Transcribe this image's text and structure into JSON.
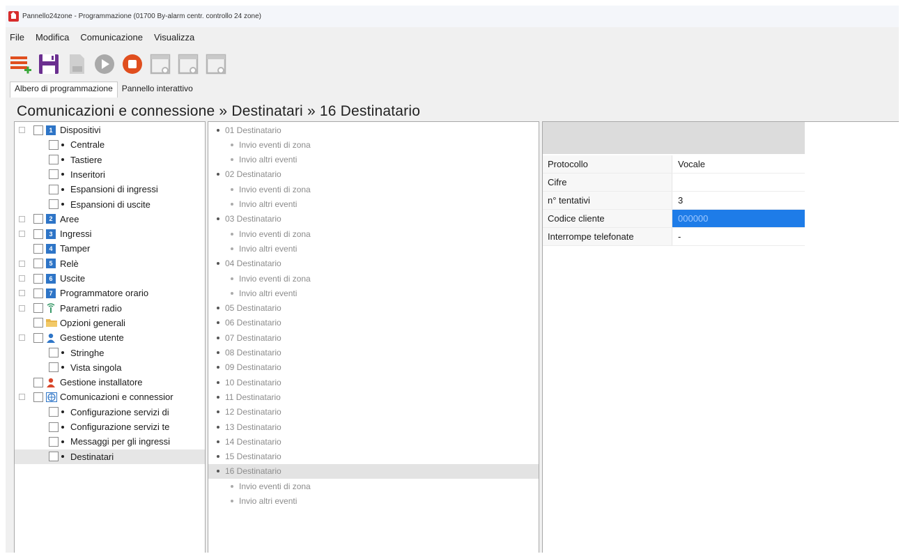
{
  "window": {
    "title": "Pannello24zone - Programmazione (01700  By-alarm centr. controllo 24 zone)"
  },
  "menu": [
    "File",
    "Modifica",
    "Comunicazione",
    "Visualizza"
  ],
  "toolbar": {
    "icons": [
      "list-add-icon",
      "save-icon",
      "document-icon",
      "play-icon",
      "stop-icon",
      "window-icon",
      "window-icon",
      "window-icon"
    ],
    "colors": {
      "red": "#e04e1e",
      "purple": "#6b2f90",
      "grey": "#a9a9a9"
    }
  },
  "tabs": [
    "Albero di programmazione",
    "Pannello interattivo"
  ],
  "breadcrumb": "Comunicazioni e connessione » Destinatari » 16 Destinatario",
  "tree": [
    {
      "label": "Dispositivi",
      "level": 0,
      "expander": "⊟",
      "icon": "1"
    },
    {
      "label": "Centrale",
      "level": 1
    },
    {
      "label": "Tastiere",
      "level": 1
    },
    {
      "label": "Inseritori",
      "level": 1
    },
    {
      "label": "Espansioni di ingressi",
      "level": 1
    },
    {
      "label": "Espansioni di uscite",
      "level": 1
    },
    {
      "label": "Aree",
      "level": 0,
      "expander": "⊞",
      "icon": "2"
    },
    {
      "label": "Ingressi",
      "level": 0,
      "expander": "⊞",
      "icon": "3"
    },
    {
      "label": "Tamper",
      "level": 0,
      "icon": "4"
    },
    {
      "label": "Relè",
      "level": 0,
      "expander": "⊞",
      "icon": "5"
    },
    {
      "label": "Uscite",
      "level": 0,
      "expander": "⊞",
      "icon": "6"
    },
    {
      "label": "Programmatore orario",
      "level": 0,
      "expander": "⊞",
      "icon": "7"
    },
    {
      "label": "Parametri radio",
      "level": 0,
      "expander": "⊞",
      "icon": "radio-antenna-icon"
    },
    {
      "label": "Opzioni generali",
      "level": 0,
      "icon": "folder-icon"
    },
    {
      "label": "Gestione utente",
      "level": 0,
      "expander": "⊟",
      "icon": "user-icon"
    },
    {
      "label": "Stringhe",
      "level": 1
    },
    {
      "label": "Vista singola",
      "level": 1
    },
    {
      "label": "Gestione installatore",
      "level": 0,
      "icon": "installer-icon"
    },
    {
      "label": "Comunicazioni e connessior",
      "level": 0,
      "expander": "⊟",
      "icon": "globe-icon"
    },
    {
      "label": "Configurazione servizi di",
      "level": 1
    },
    {
      "label": "Configurazione servizi te",
      "level": 1
    },
    {
      "label": "Messaggi per gli ingressi",
      "level": 1
    },
    {
      "label": "Destinatari",
      "level": 1,
      "selected": true
    }
  ],
  "recipients": [
    {
      "label": "01 Destinatario",
      "level": 0
    },
    {
      "label": "Invio eventi di zona",
      "level": 1
    },
    {
      "label": "Invio altri eventi",
      "level": 1
    },
    {
      "label": "02 Destinatario",
      "level": 0
    },
    {
      "label": "Invio eventi di zona",
      "level": 1
    },
    {
      "label": "Invio altri eventi",
      "level": 1
    },
    {
      "label": "03 Destinatario",
      "level": 0
    },
    {
      "label": "Invio eventi di zona",
      "level": 1
    },
    {
      "label": "Invio altri eventi",
      "level": 1
    },
    {
      "label": "04 Destinatario",
      "level": 0
    },
    {
      "label": "Invio eventi di zona",
      "level": 1
    },
    {
      "label": "Invio altri eventi",
      "level": 1
    },
    {
      "label": "05 Destinatario",
      "level": 0
    },
    {
      "label": "06 Destinatario",
      "level": 0
    },
    {
      "label": "07 Destinatario",
      "level": 0
    },
    {
      "label": "08 Destinatario",
      "level": 0
    },
    {
      "label": "09 Destinatario",
      "level": 0
    },
    {
      "label": "10 Destinatario",
      "level": 0
    },
    {
      "label": "11 Destinatario",
      "level": 0
    },
    {
      "label": "12 Destinatario",
      "level": 0
    },
    {
      "label": "13 Destinatario",
      "level": 0
    },
    {
      "label": "14 Destinatario",
      "level": 0
    },
    {
      "label": "15 Destinatario",
      "level": 0
    },
    {
      "label": "16 Destinatario",
      "level": 0,
      "selected": true
    },
    {
      "label": "Invio eventi di zona",
      "level": 1
    },
    {
      "label": "Invio altri eventi",
      "level": 1
    }
  ],
  "properties": [
    {
      "label": "Protocollo",
      "value": "Vocale"
    },
    {
      "label": "Cifre",
      "value": ""
    },
    {
      "label": "n° tentativi",
      "value": "3"
    },
    {
      "label": "Codice cliente",
      "value": "000000",
      "selected": true
    },
    {
      "label": "Interrompe telefonate",
      "value": "-"
    }
  ],
  "colors": {
    "selection": "#1e7ce8",
    "tree_icon": "#2e75c7"
  }
}
